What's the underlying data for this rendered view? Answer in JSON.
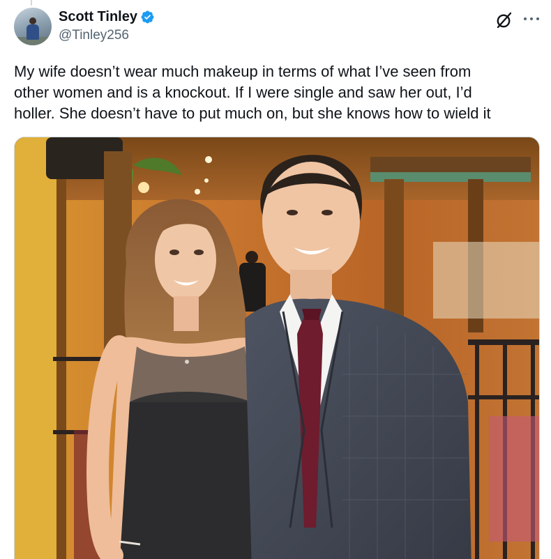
{
  "author": {
    "display_name": "Scott Tinley",
    "handle": "@Tinley256",
    "verified": true,
    "verified_color": "#1d9bf0"
  },
  "tweet": {
    "text": "My wife doesn’t wear much makeup in terms of what I’ve seen from\nother women and is a knockout. If I were single and saw her out, I’d\nholler. She doesn’t have to put much on, but she knows how to wield it"
  },
  "icons": {
    "verified": "verified-badge-icon",
    "grok": "grok-icon",
    "more": "more-options-icon"
  },
  "colors": {
    "text_primary": "#0f1419",
    "text_secondary": "#536471",
    "accent": "#1d9bf0"
  }
}
